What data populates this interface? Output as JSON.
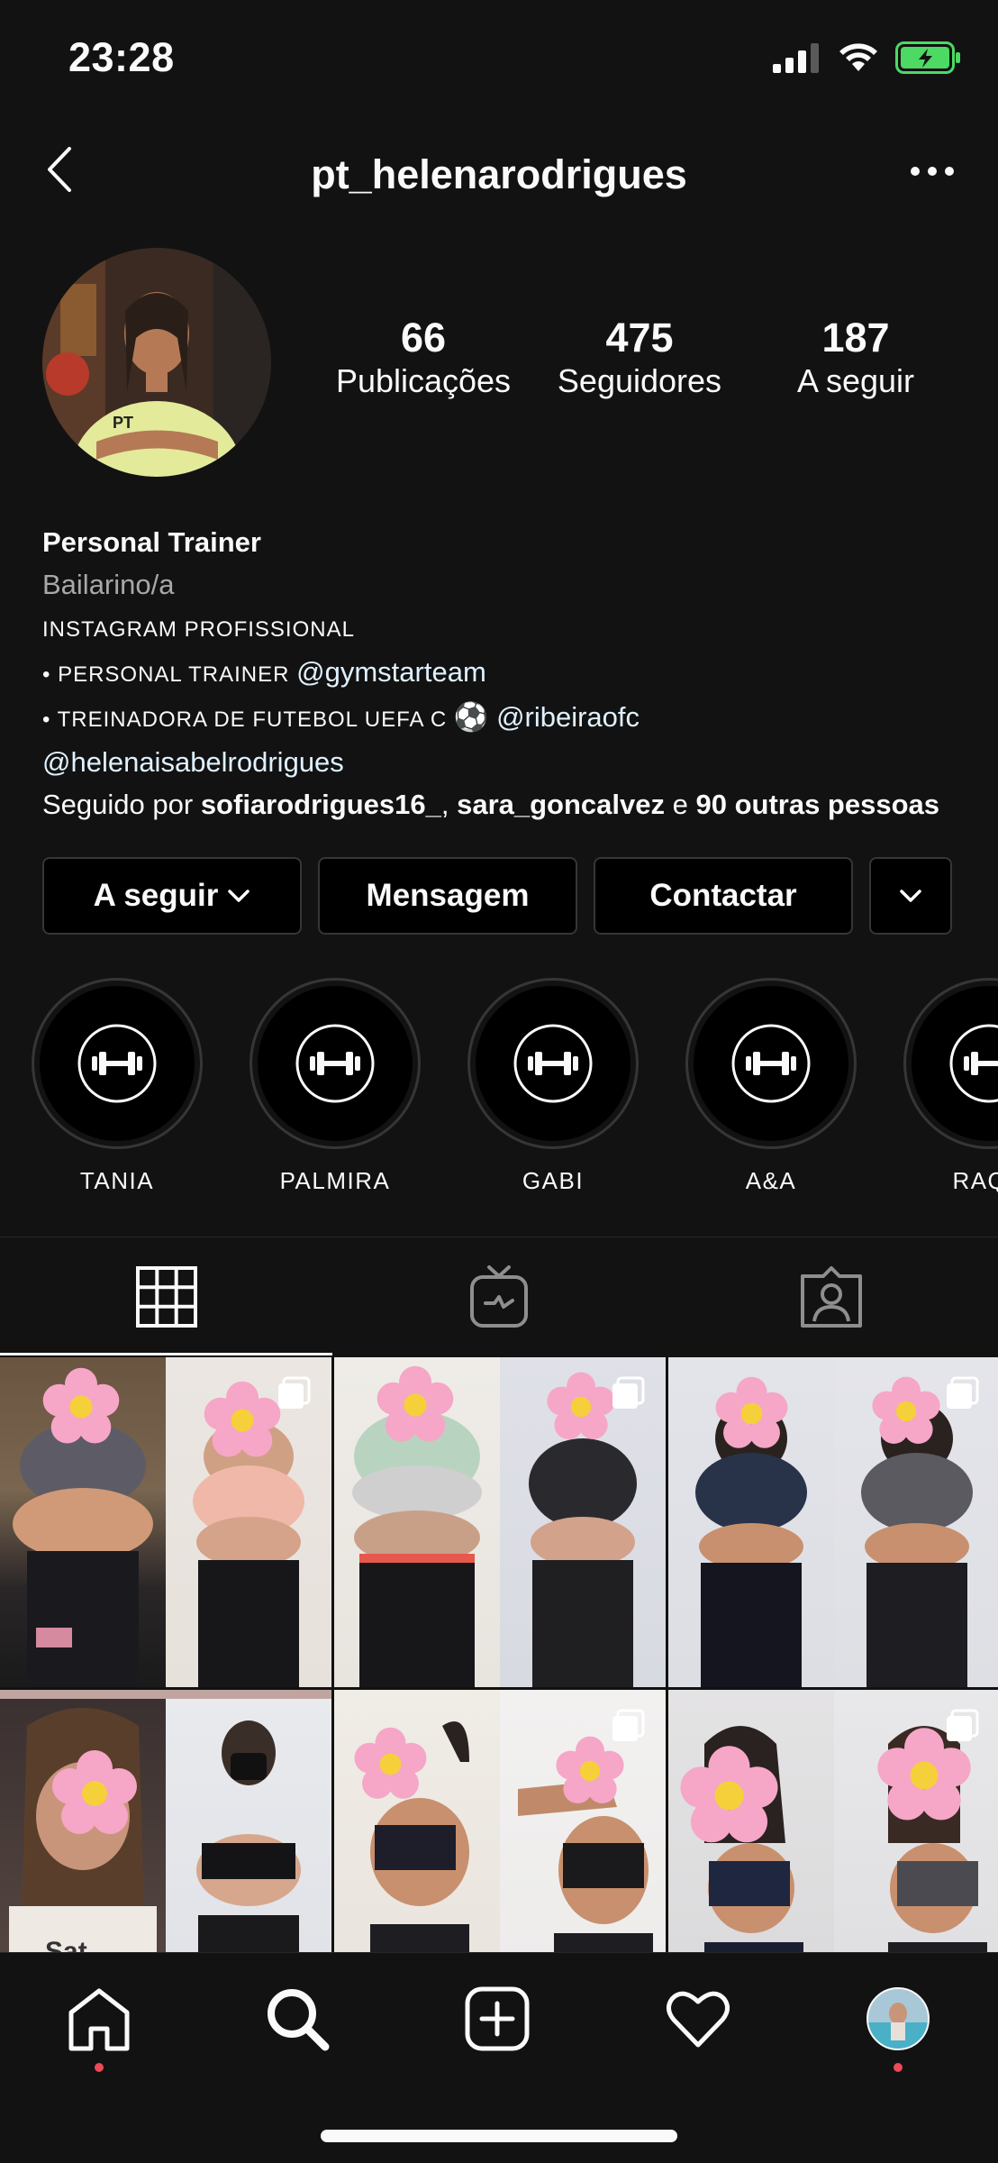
{
  "status_bar": {
    "time": "23:28"
  },
  "header": {
    "username": "pt_helenarodrigues"
  },
  "stats": [
    {
      "num": "66",
      "label": "Publicações"
    },
    {
      "num": "475",
      "label": "Seguidores"
    },
    {
      "num": "187",
      "label": "A seguir"
    }
  ],
  "bio": {
    "name": "Personal Trainer",
    "category": "Bailarino/a",
    "line1": "INSTAGRAM PROFISSIONAL",
    "line2_prefix": "• PERSONAL TRAINER ",
    "line2_mention": "@gymstarteam",
    "line3_prefix": "• TREINADORA DE FUTEBOL UEFA C ",
    "line3_emoji": "⚽",
    "line3_mention": "@ribeiraofc",
    "line4_mention": "@helenaisabelrodrigues",
    "followed_prefix": "Seguido por ",
    "followed_user1": "sofiarodrigues16_",
    "followed_sep": ", ",
    "followed_user2": "sara_goncalvez",
    "followed_and": " e ",
    "followed_others": "90 outras pessoas"
  },
  "actions": {
    "following_label": "A seguir",
    "message_label": "Mensagem",
    "contact_label": "Contactar"
  },
  "highlights": [
    {
      "label": "TANIA"
    },
    {
      "label": "PALMIRA"
    },
    {
      "label": "GABI"
    },
    {
      "label": "A&A"
    },
    {
      "label": "RAQU"
    }
  ],
  "tabs": [
    "grid-icon",
    "igtv-icon",
    "tagged-icon"
  ],
  "colors": {
    "background": "#121212",
    "text": "#fafafa",
    "secondary": "#a8a8a8",
    "border": "#363636",
    "notification": "#ed4956",
    "battery": "#4cd964"
  }
}
